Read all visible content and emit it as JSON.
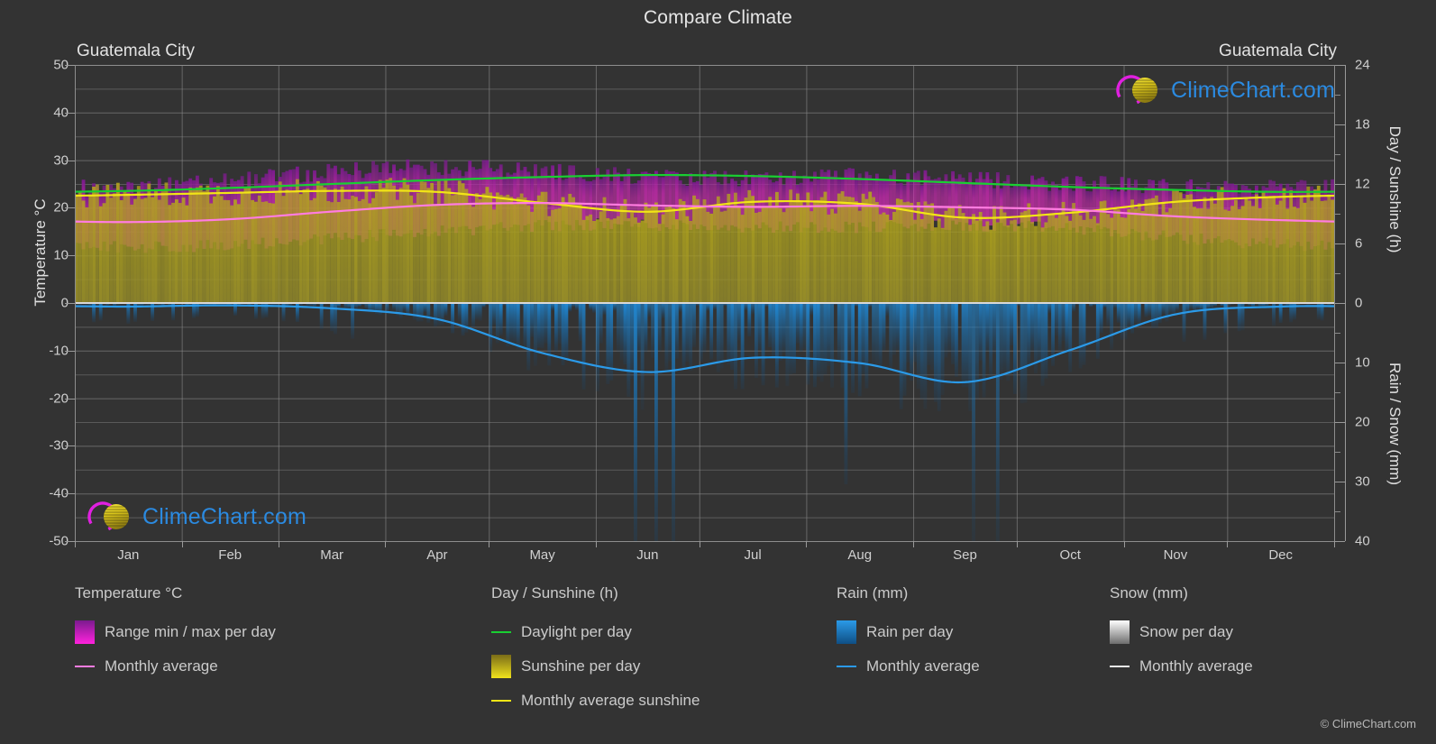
{
  "header": {
    "title": "Compare Climate",
    "city_left": "Guatemala City",
    "city_right": "Guatemala City"
  },
  "axes": {
    "left_title": "Temperature °C",
    "right_title_top": "Day / Sunshine (h)",
    "right_title_bottom": "Rain / Snow (mm)",
    "left_ticks": [
      "50",
      "40",
      "30",
      "20",
      "10",
      "0",
      "-10",
      "-20",
      "-30",
      "-40",
      "-50"
    ],
    "right_ticks_top": [
      "24",
      "18",
      "12",
      "6",
      "0"
    ],
    "right_ticks_bottom": [
      "10",
      "20",
      "30",
      "40"
    ],
    "x_ticks": [
      "Jan",
      "Feb",
      "Mar",
      "Apr",
      "May",
      "Jun",
      "Jul",
      "Aug",
      "Sep",
      "Oct",
      "Nov",
      "Dec"
    ]
  },
  "legend": {
    "temperature": {
      "heading": "Temperature °C",
      "items": [
        {
          "label": "Range min / max per day",
          "mark": "gradient-magenta"
        },
        {
          "label": "Monthly average",
          "mark": "line-pink"
        }
      ]
    },
    "day_sunshine": {
      "heading": "Day / Sunshine (h)",
      "items": [
        {
          "label": "Daylight per day",
          "mark": "line-green"
        },
        {
          "label": "Sunshine per day",
          "mark": "gradient-yellow"
        },
        {
          "label": "Monthly average sunshine",
          "mark": "line-yellow"
        }
      ]
    },
    "rain": {
      "heading": "Rain (mm)",
      "items": [
        {
          "label": "Rain per day",
          "mark": "gradient-blue"
        },
        {
          "label": "Monthly average",
          "mark": "line-blue"
        }
      ]
    },
    "snow": {
      "heading": "Snow (mm)",
      "items": [
        {
          "label": "Snow per day",
          "mark": "gradient-white"
        },
        {
          "label": "Monthly average",
          "mark": "line-white"
        }
      ]
    },
    "copyright": "© ClimeChart.com"
  },
  "watermark": {
    "text": "ClimeChart.com"
  },
  "colors": {
    "background": "#333333",
    "grid": "#8a8a8a",
    "temp_range": "#d511d5",
    "temp_avg_line": "#ff7ce0",
    "daylight_line": "#19cf32",
    "sunshine_band": "#9a9a28",
    "sunshine_avg_line": "#f2e516",
    "rain_band": "#1e86d6",
    "rain_avg_line": "#2b9ae8",
    "snow_band": "#ffffff",
    "brand_blue": "#2b8ae0",
    "brand_magenta": "#e020e0",
    "brand_yellow": "#d4c60c"
  },
  "chart_data": {
    "type": "area",
    "title": "Compare Climate",
    "subtitle": "Guatemala City",
    "xlabel": "",
    "ylabel": "Temperature °C",
    "ylim": [
      -50,
      50
    ],
    "y2lim_top": [
      0,
      24
    ],
    "y2lim_bottom": [
      0,
      40
    ],
    "grid": true,
    "legend_position": "bottom",
    "categories": [
      "Jan",
      "Feb",
      "Mar",
      "Apr",
      "May",
      "Jun",
      "Jul",
      "Aug",
      "Sep",
      "Oct",
      "Nov",
      "Dec"
    ],
    "series": [
      {
        "name": "Temperature monthly average (°C)",
        "color": "#ff7ce0",
        "values": [
          17.0,
          17.6,
          19.2,
          20.6,
          21.0,
          20.5,
          20.2,
          20.4,
          20.1,
          19.6,
          18.2,
          17.4
        ]
      },
      {
        "name": "Temperature daily max (°C)",
        "color": "#d511d5",
        "values": [
          24.4,
          25.6,
          27.4,
          28.3,
          27.6,
          26.2,
          26.0,
          26.4,
          25.7,
          25.0,
          24.3,
          24.0
        ]
      },
      {
        "name": "Temperature daily min (°C)",
        "color": "#d511d5",
        "values": [
          11.8,
          12.2,
          13.6,
          15.0,
          16.3,
          16.4,
          16.0,
          16.0,
          16.1,
          15.6,
          13.7,
          12.3
        ]
      },
      {
        "name": "Daylight per day (h)",
        "color": "#19cf32",
        "values": [
          11.3,
          11.6,
          12.0,
          12.4,
          12.7,
          12.9,
          12.8,
          12.5,
          12.1,
          11.7,
          11.4,
          11.2
        ]
      },
      {
        "name": "Monthly average sunshine (h)",
        "color": "#f2e516",
        "values": [
          10.9,
          11.1,
          11.3,
          11.2,
          10.1,
          9.2,
          10.2,
          10.0,
          8.6,
          9.1,
          10.2,
          10.7
        ]
      },
      {
        "name": "Rain monthly average (mm)",
        "color": "#2b9ae8",
        "values": [
          0.6,
          0.4,
          0.9,
          2.7,
          8.4,
          11.6,
          9.2,
          10.1,
          13.3,
          7.9,
          1.9,
          0.6
        ]
      }
    ]
  }
}
